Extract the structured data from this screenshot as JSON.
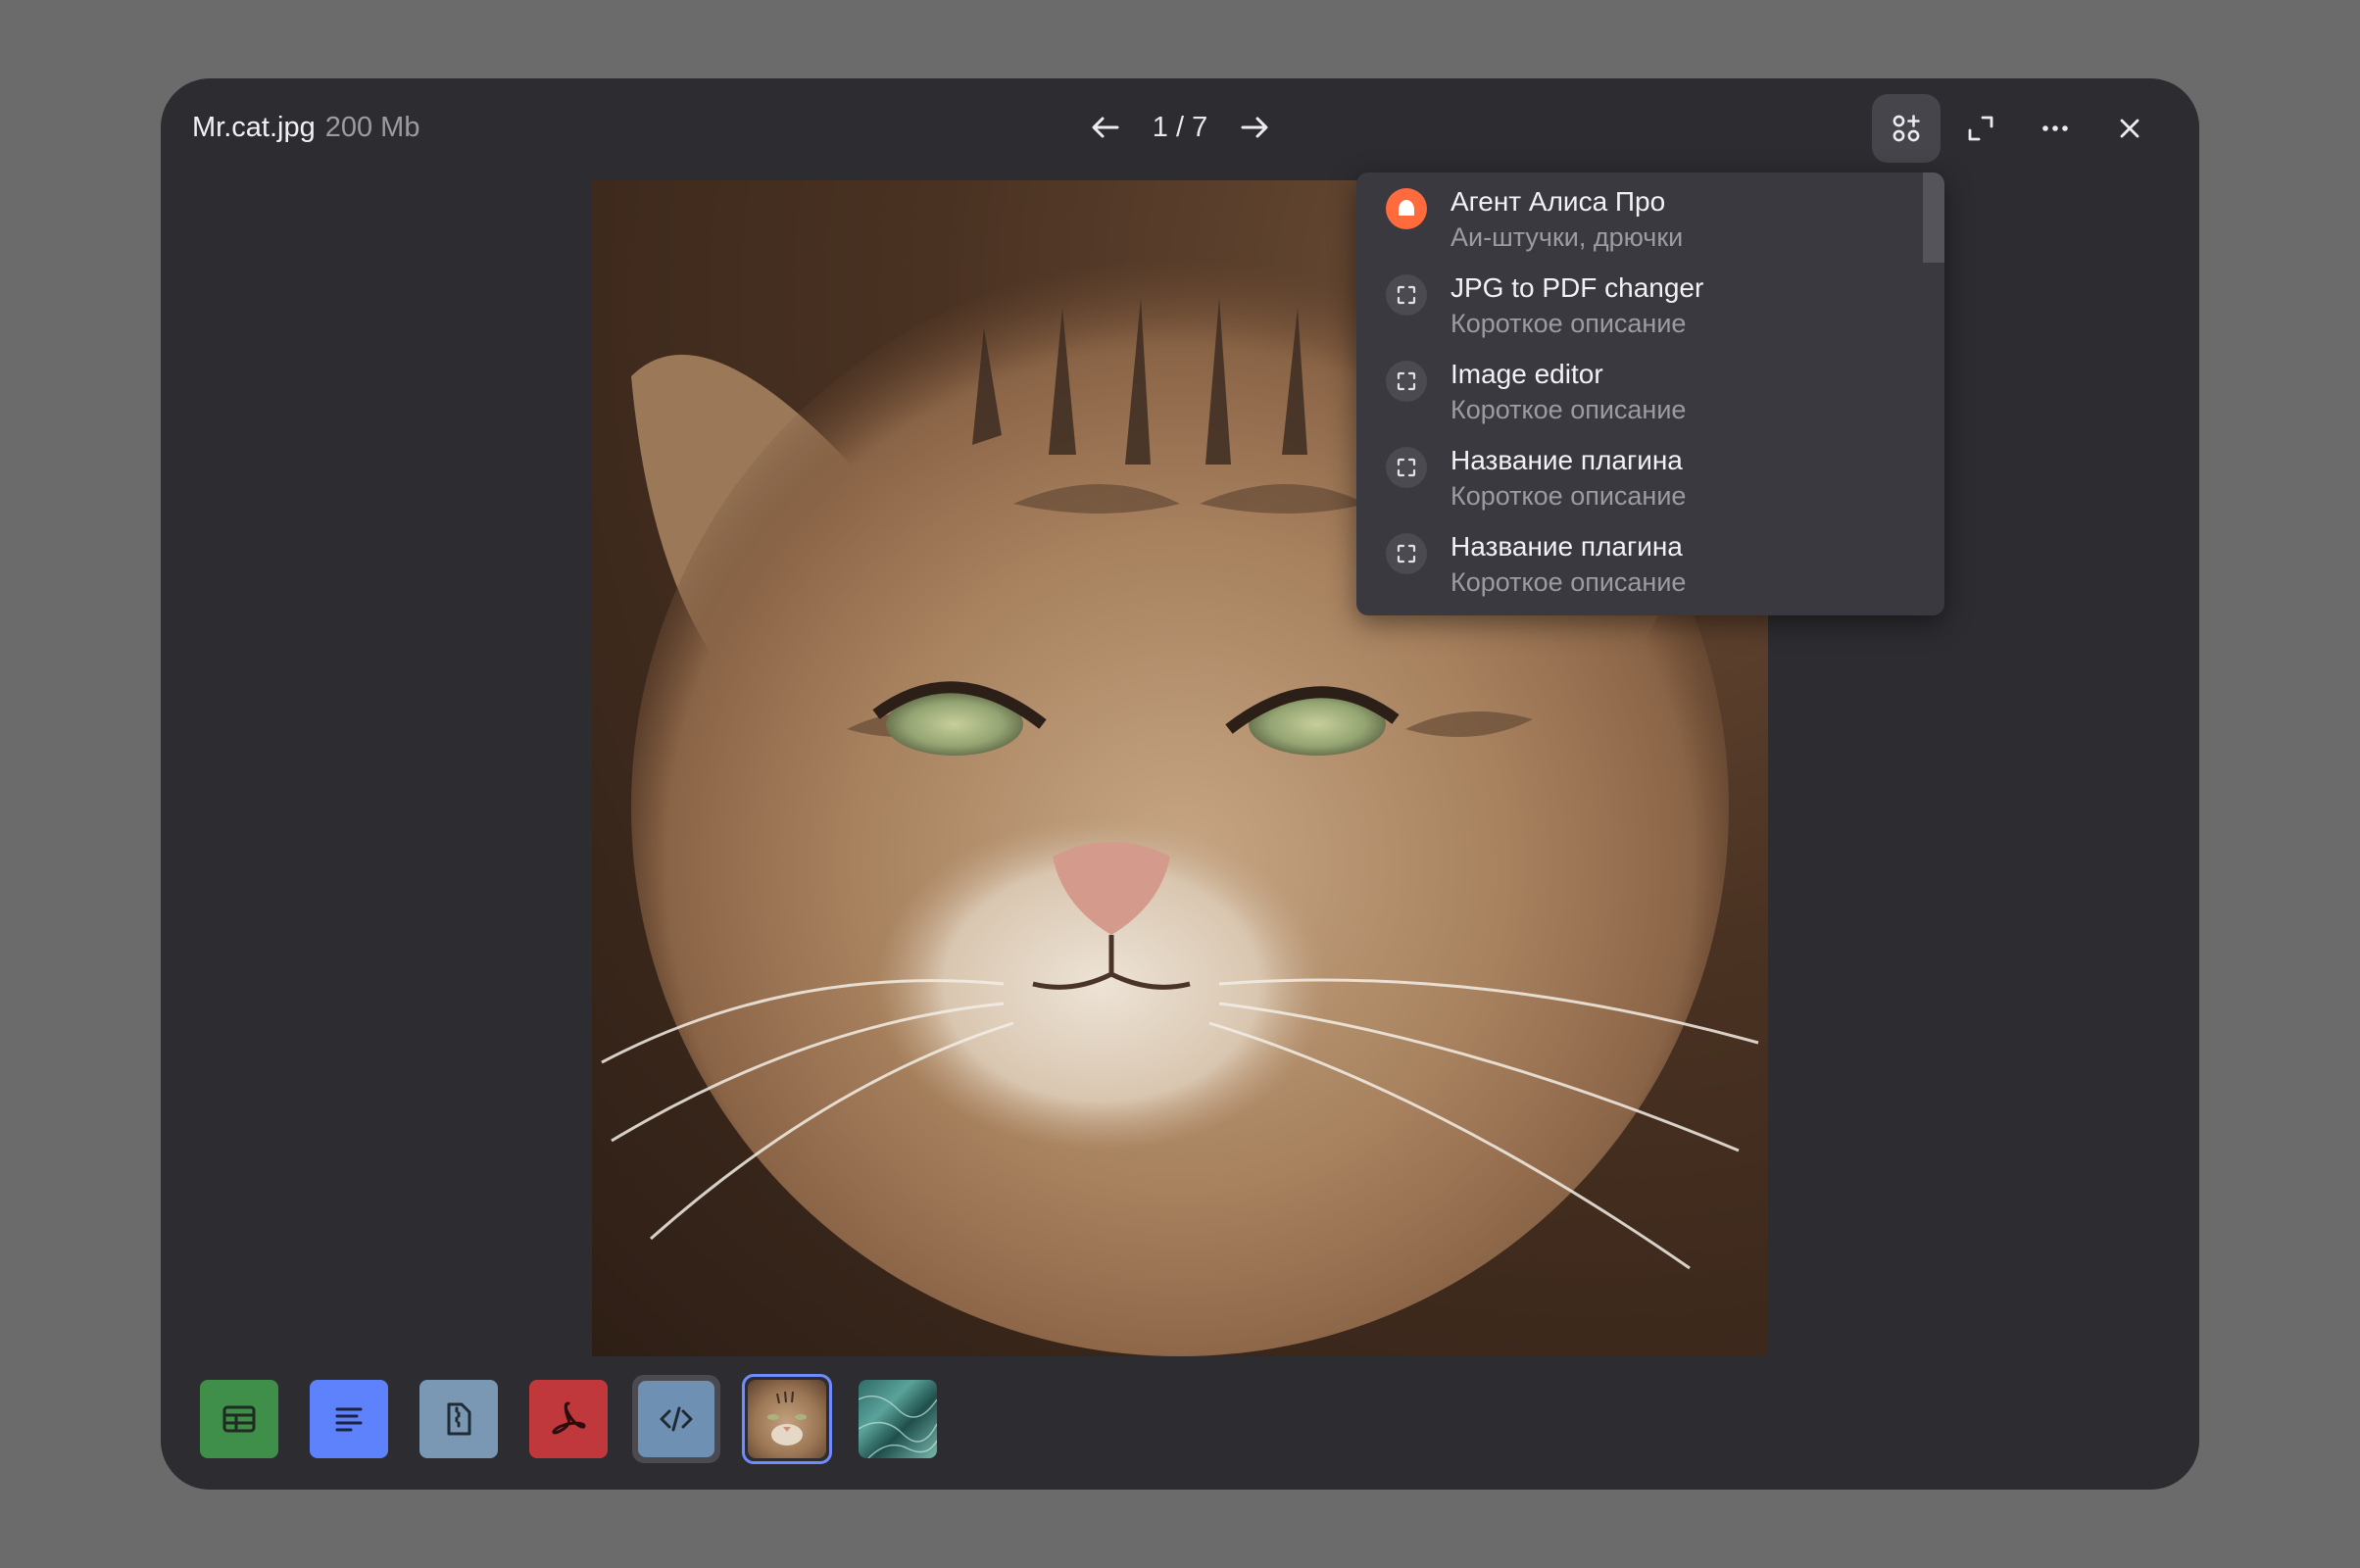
{
  "file": {
    "name": "Mr.cat.jpg",
    "size": "200 Mb"
  },
  "pager": {
    "label": "1 / 7"
  },
  "toolbar": {
    "apps": "apps-add-icon",
    "fullscreen": "fullscreen-icon",
    "more": "more-icon",
    "close": "close-icon"
  },
  "plugins": [
    {
      "title": "Агент Алиса Про",
      "description": "Аи-штучки, дрючки",
      "icon": "alice-icon"
    },
    {
      "title": "JPG to PDF changer",
      "description": "Короткое описание",
      "icon": "plugin-frame-icon"
    },
    {
      "title": "Image editor",
      "description": "Короткое описание",
      "icon": "plugin-frame-icon"
    },
    {
      "title": "Название плагина",
      "description": "Короткое описание",
      "icon": "plugin-frame-icon"
    },
    {
      "title": "Название плагина",
      "description": "Короткое описание",
      "icon": "plugin-frame-icon"
    }
  ],
  "thumbnails": [
    {
      "type": "spreadsheet",
      "color": "#3f8f4a"
    },
    {
      "type": "text",
      "color": "#5d82fb"
    },
    {
      "type": "archive",
      "color": "#7a98b3"
    },
    {
      "type": "pdf",
      "color": "#c0373c"
    },
    {
      "type": "code",
      "color": "#6e90b3"
    },
    {
      "type": "image-cat"
    },
    {
      "type": "image-texture"
    }
  ],
  "colors": {
    "background": "#6b6b6b",
    "viewer": "#2d2c31",
    "menu": "#3a3940",
    "accent": "#6f8cff",
    "alice": "#ff6b3d"
  }
}
